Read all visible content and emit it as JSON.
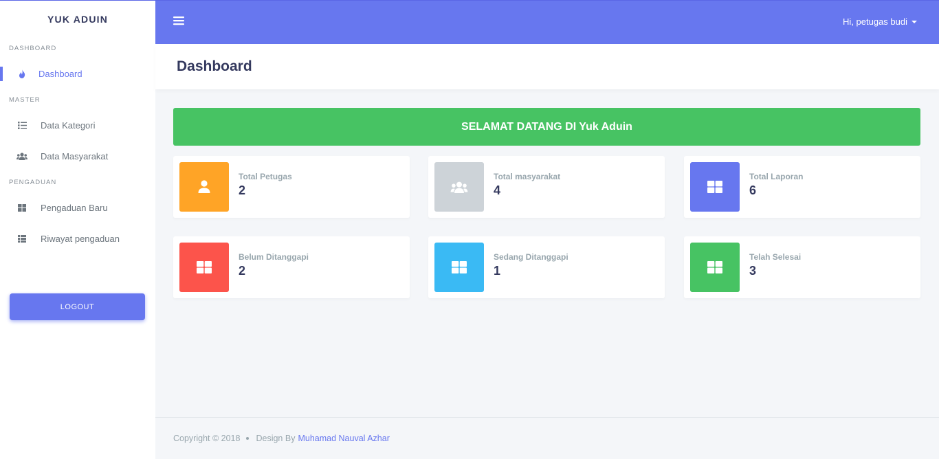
{
  "sidebar": {
    "brand": "YUK ADUIN",
    "sections": [
      {
        "header": "DASHBOARD",
        "items": [
          {
            "label": "Dashboard",
            "icon": "fire-icon",
            "active": true
          }
        ]
      },
      {
        "header": "MASTER",
        "items": [
          {
            "label": "Data Kategori",
            "icon": "list-icon"
          },
          {
            "label": "Data Masyarakat",
            "icon": "users-icon"
          }
        ]
      },
      {
        "header": "PENGADUAN",
        "items": [
          {
            "label": "Pengaduan Baru",
            "icon": "grid-icon"
          },
          {
            "label": "Riwayat pengaduan",
            "icon": "table-list-icon"
          }
        ]
      }
    ],
    "logout_label": "LOGOUT"
  },
  "navbar": {
    "user_greeting": "Hi, petugas budi"
  },
  "page": {
    "title": "Dashboard"
  },
  "welcome": "SELAMAT DATANG DI Yuk Aduin",
  "stats": [
    {
      "label": "Total Petugas",
      "value": "2",
      "icon": "user-icon",
      "color": "#ffa426"
    },
    {
      "label": "Total masyarakat",
      "value": "4",
      "icon": "users-icon",
      "color": "#cdd3d8"
    },
    {
      "label": "Total Laporan",
      "value": "6",
      "icon": "window-icon",
      "color": "#6777ef"
    },
    {
      "label": "Belum Ditanggapi",
      "value": "2",
      "icon": "window-icon",
      "color": "#fc544b"
    },
    {
      "label": "Sedang Ditanggapi",
      "value": "1",
      "icon": "window-icon",
      "color": "#3abaf4"
    },
    {
      "label": "Telah Selesai",
      "value": "3",
      "icon": "window-icon",
      "color": "#47c363"
    }
  ],
  "footer": {
    "copyright": "Copyright © 2018",
    "design_by": "Design By",
    "author": "Muhamad Nauval Azhar"
  },
  "colors": {
    "primary": "#6777ef",
    "success": "#47c363",
    "text": "#34395e",
    "muted": "#98a6ad"
  }
}
